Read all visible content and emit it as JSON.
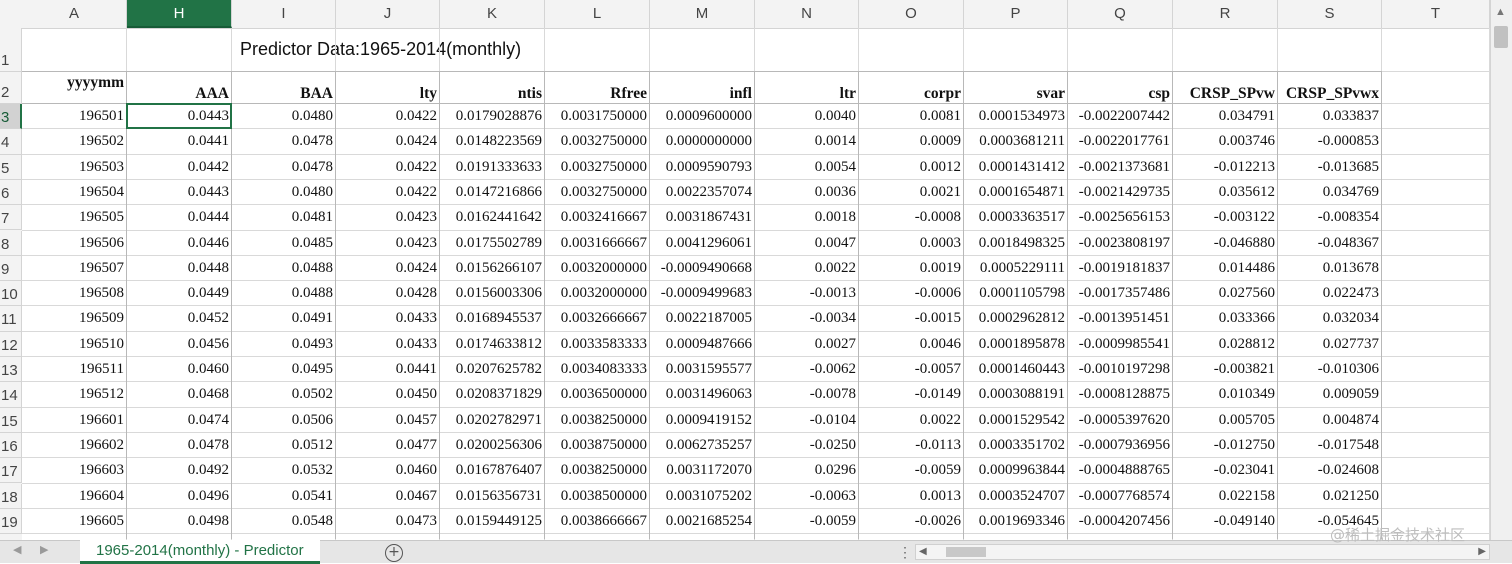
{
  "column_headers": [
    "A",
    "H",
    "I",
    "J",
    "K",
    "L",
    "M",
    "N",
    "O",
    "P",
    "Q",
    "R",
    "S",
    "T"
  ],
  "selected_column": "H",
  "row_numbers": [
    "1",
    "2",
    "3",
    "4",
    "5",
    "6",
    "7",
    "8",
    "9",
    "10",
    "11",
    "12",
    "13",
    "14",
    "15",
    "16",
    "17",
    "18",
    "19"
  ],
  "title": "Predictor Data:1965-2014(monthly)",
  "field_headers": [
    "yyyymm",
    "AAA",
    "BAA",
    "lty",
    "ntis",
    "Rfree",
    "infl",
    "ltr",
    "corpr",
    "svar",
    "csp",
    "CRSP_SPvw",
    "CRSP_SPvwx"
  ],
  "rows": [
    [
      "196501",
      "0.0443",
      "0.0480",
      "0.0422",
      "0.0179028876",
      "0.0031750000",
      "0.0009600000",
      "0.0040",
      "0.0081",
      "0.0001534973",
      "-0.0022007442",
      "0.034791",
      "0.033837"
    ],
    [
      "196502",
      "0.0441",
      "0.0478",
      "0.0424",
      "0.0148223569",
      "0.0032750000",
      "0.0000000000",
      "0.0014",
      "0.0009",
      "0.0003681211",
      "-0.0022017761",
      "0.003746",
      "-0.000853"
    ],
    [
      "196503",
      "0.0442",
      "0.0478",
      "0.0422",
      "0.0191333633",
      "0.0032750000",
      "0.0009590793",
      "0.0054",
      "0.0012",
      "0.0001431412",
      "-0.0021373681",
      "-0.012213",
      "-0.013685"
    ],
    [
      "196504",
      "0.0443",
      "0.0480",
      "0.0422",
      "0.0147216866",
      "0.0032750000",
      "0.0022357074",
      "0.0036",
      "0.0021",
      "0.0001654871",
      "-0.0021429735",
      "0.035612",
      "0.034769"
    ],
    [
      "196505",
      "0.0444",
      "0.0481",
      "0.0423",
      "0.0162441642",
      "0.0032416667",
      "0.0031867431",
      "0.0018",
      "-0.0008",
      "0.0003363517",
      "-0.0025656153",
      "-0.003122",
      "-0.008354"
    ],
    [
      "196506",
      "0.0446",
      "0.0485",
      "0.0423",
      "0.0175502789",
      "0.0031666667",
      "0.0041296061",
      "0.0047",
      "0.0003",
      "0.0018498325",
      "-0.0023808197",
      "-0.046880",
      "-0.048367"
    ],
    [
      "196507",
      "0.0448",
      "0.0488",
      "0.0424",
      "0.0156266107",
      "0.0032000000",
      "-0.0009490668",
      "0.0022",
      "0.0019",
      "0.0005229111",
      "-0.0019181837",
      "0.014486",
      "0.013678"
    ],
    [
      "196508",
      "0.0449",
      "0.0488",
      "0.0428",
      "0.0156003306",
      "0.0032000000",
      "-0.0009499683",
      "-0.0013",
      "-0.0006",
      "0.0001105798",
      "-0.0017357486",
      "0.027560",
      "0.022473"
    ],
    [
      "196509",
      "0.0452",
      "0.0491",
      "0.0433",
      "0.0168945537",
      "0.0032666667",
      "0.0022187005",
      "-0.0034",
      "-0.0015",
      "0.0002962812",
      "-0.0013951451",
      "0.033366",
      "0.032034"
    ],
    [
      "196510",
      "0.0456",
      "0.0493",
      "0.0433",
      "0.0174633812",
      "0.0033583333",
      "0.0009487666",
      "0.0027",
      "0.0046",
      "0.0001895878",
      "-0.0009985541",
      "0.028812",
      "0.027737"
    ],
    [
      "196511",
      "0.0460",
      "0.0495",
      "0.0441",
      "0.0207625782",
      "0.0034083333",
      "0.0031595577",
      "-0.0062",
      "-0.0057",
      "0.0001460443",
      "-0.0010197298",
      "-0.003821",
      "-0.010306"
    ],
    [
      "196512",
      "0.0468",
      "0.0502",
      "0.0450",
      "0.0208371829",
      "0.0036500000",
      "0.0031496063",
      "-0.0078",
      "-0.0149",
      "0.0003088191",
      "-0.0008128875",
      "0.010349",
      "0.009059"
    ],
    [
      "196601",
      "0.0474",
      "0.0506",
      "0.0457",
      "0.0202782971",
      "0.0038250000",
      "0.0009419152",
      "-0.0104",
      "0.0022",
      "0.0001529542",
      "-0.0005397620",
      "0.005705",
      "0.004874"
    ],
    [
      "196602",
      "0.0478",
      "0.0512",
      "0.0477",
      "0.0200256306",
      "0.0038750000",
      "0.0062735257",
      "-0.0250",
      "-0.0113",
      "0.0003351702",
      "-0.0007936956",
      "-0.012750",
      "-0.017548"
    ],
    [
      "196603",
      "0.0492",
      "0.0532",
      "0.0460",
      "0.0167876407",
      "0.0038250000",
      "0.0031172070",
      "0.0296",
      "-0.0059",
      "0.0009963844",
      "-0.0004888765",
      "-0.023041",
      "-0.024608"
    ],
    [
      "196604",
      "0.0496",
      "0.0541",
      "0.0467",
      "0.0156356731",
      "0.0038500000",
      "0.0031075202",
      "-0.0063",
      "0.0013",
      "0.0003524707",
      "-0.0007768574",
      "0.022158",
      "0.021250"
    ],
    [
      "196605",
      "0.0498",
      "0.0548",
      "0.0473",
      "0.0159449125",
      "0.0038666667",
      "0.0021685254",
      "-0.0059",
      "-0.0026",
      "0.0019693346",
      "-0.0004207456",
      "-0.049140",
      "-0.054645"
    ]
  ],
  "sheet_tab_label": "1965-2014(monthly) - Predictor",
  "add_sheet_label": "+",
  "tab_separator": "⋮",
  "watermark": "@稀土掘金技术社区",
  "colors": {
    "accent": "#217346",
    "gridline": "#d9d9d9",
    "header_bg": "#f3f3f3"
  },
  "icons": {
    "scroll_up": "triangle-up-icon",
    "add_sheet": "plus-circle-icon",
    "nav_prev": "triangle-left-icon",
    "nav_next": "triangle-right-icon"
  }
}
